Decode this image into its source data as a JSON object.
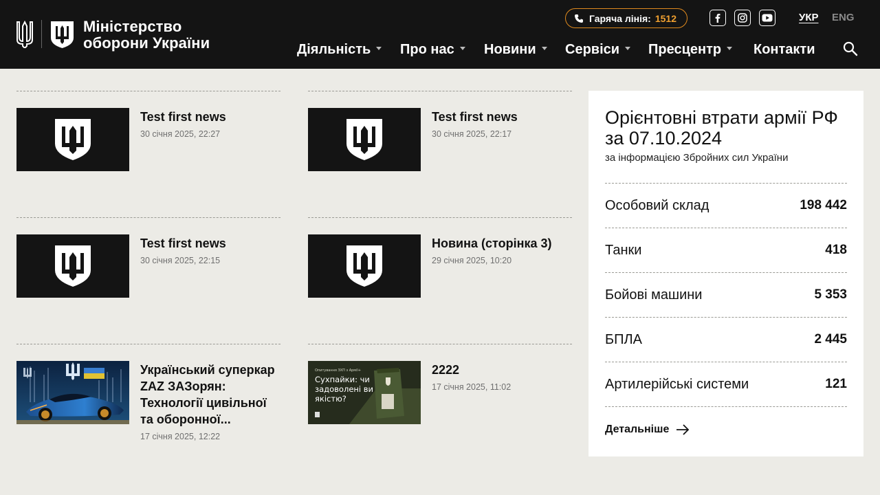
{
  "header": {
    "org_line1": "Міністерство",
    "org_line2": "оборони України",
    "hotline_label": "Гаряча лінія:",
    "hotline_number": "1512",
    "lang_active": "УКР",
    "lang_other": "ENG",
    "nav": [
      {
        "label": "Діяльність",
        "has_dropdown": true
      },
      {
        "label": "Про нас",
        "has_dropdown": true
      },
      {
        "label": "Новини",
        "has_dropdown": true
      },
      {
        "label": "Сервіси",
        "has_dropdown": true
      },
      {
        "label": "Пресцентр",
        "has_dropdown": true
      },
      {
        "label": "Контакти",
        "has_dropdown": false
      }
    ],
    "icons": [
      "trident-logo-icon",
      "mod-shield-logo-icon",
      "phone-icon",
      "facebook-icon",
      "instagram-icon",
      "youtube-icon",
      "search-icon"
    ]
  },
  "news": [
    {
      "title": "Test first news",
      "date": "30 січня 2025, 22:27",
      "thumb": "mod-logo"
    },
    {
      "title": "Test first news",
      "date": "30 січня 2025, 22:17",
      "thumb": "mod-logo"
    },
    {
      "title": "Test first news",
      "date": "30 січня 2025, 22:15",
      "thumb": "mod-logo"
    },
    {
      "title": "Новина (сторінка 3)",
      "date": "29 січня 2025, 10:20",
      "thumb": "mod-logo"
    },
    {
      "title": "Український суперкар ZAZ ЗАЗорян: Технології цивільної та оборонної...",
      "title_lines": [
        "Український суперкар",
        "ZAZ ЗАЗорян:",
        "Технології цивільної",
        "та оборонної..."
      ],
      "date": "17 січня 2025, 12:22",
      "thumb": "supercar-photo"
    },
    {
      "title": "2222",
      "date": "17 січня 2025, 11:02",
      "thumb": "ration-promo",
      "thumb_caption_small": "Опитування ЗХП з Армії+",
      "thumb_caption": "Сухпайки: чи задоволені ви якістю?"
    }
  ],
  "losses": {
    "title": "Орієнтовні втрати армії РФ за 07.10.2024",
    "subtitle": "за інформацією Збройних сил України",
    "items": [
      {
        "label": "Особовий склад",
        "value": "198 442"
      },
      {
        "label": "Танки",
        "value": "418"
      },
      {
        "label": "Бойові машини",
        "value": "5 353"
      },
      {
        "label": "БПЛА",
        "value": "2 445"
      },
      {
        "label": "Артилерійські системи",
        "value": "121"
      }
    ],
    "more_label": "Детальніше"
  },
  "colors": {
    "header_bg": "#141414",
    "page_bg": "#ecebe6",
    "accent": "#f0a030",
    "panel_bg": "#ffffff"
  }
}
